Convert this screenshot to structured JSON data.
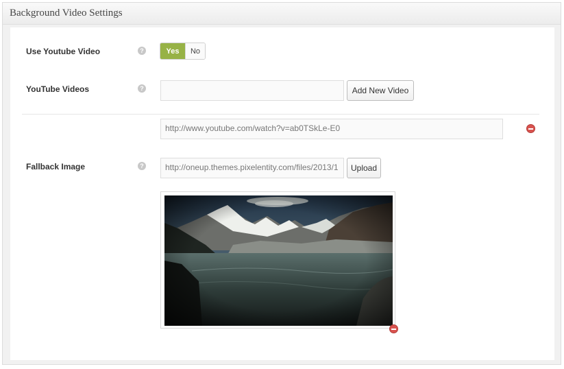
{
  "panel": {
    "title": "Background Video Settings"
  },
  "fields": {
    "use_youtube": {
      "label": "Use Youtube Video",
      "help": "?",
      "yes_label": "Yes",
      "no_label": "No",
      "selected": "Yes"
    },
    "youtube_videos": {
      "label": "YouTube Videos",
      "help": "?",
      "new_value": "",
      "add_button": "Add New Video",
      "items": [
        {
          "url": "http://www.youtube.com/watch?v=ab0TSkLe-E0"
        }
      ]
    },
    "fallback_image": {
      "label": "Fallback Image",
      "help": "?",
      "value": "http://oneup.themes.pixelentity.com/files/2013/1",
      "upload_button": "Upload"
    }
  },
  "colors": {
    "accent": "#97b246",
    "remove": "#d9534f"
  },
  "icons": {
    "help": "question-circle-icon",
    "remove": "minus-circle-icon"
  }
}
